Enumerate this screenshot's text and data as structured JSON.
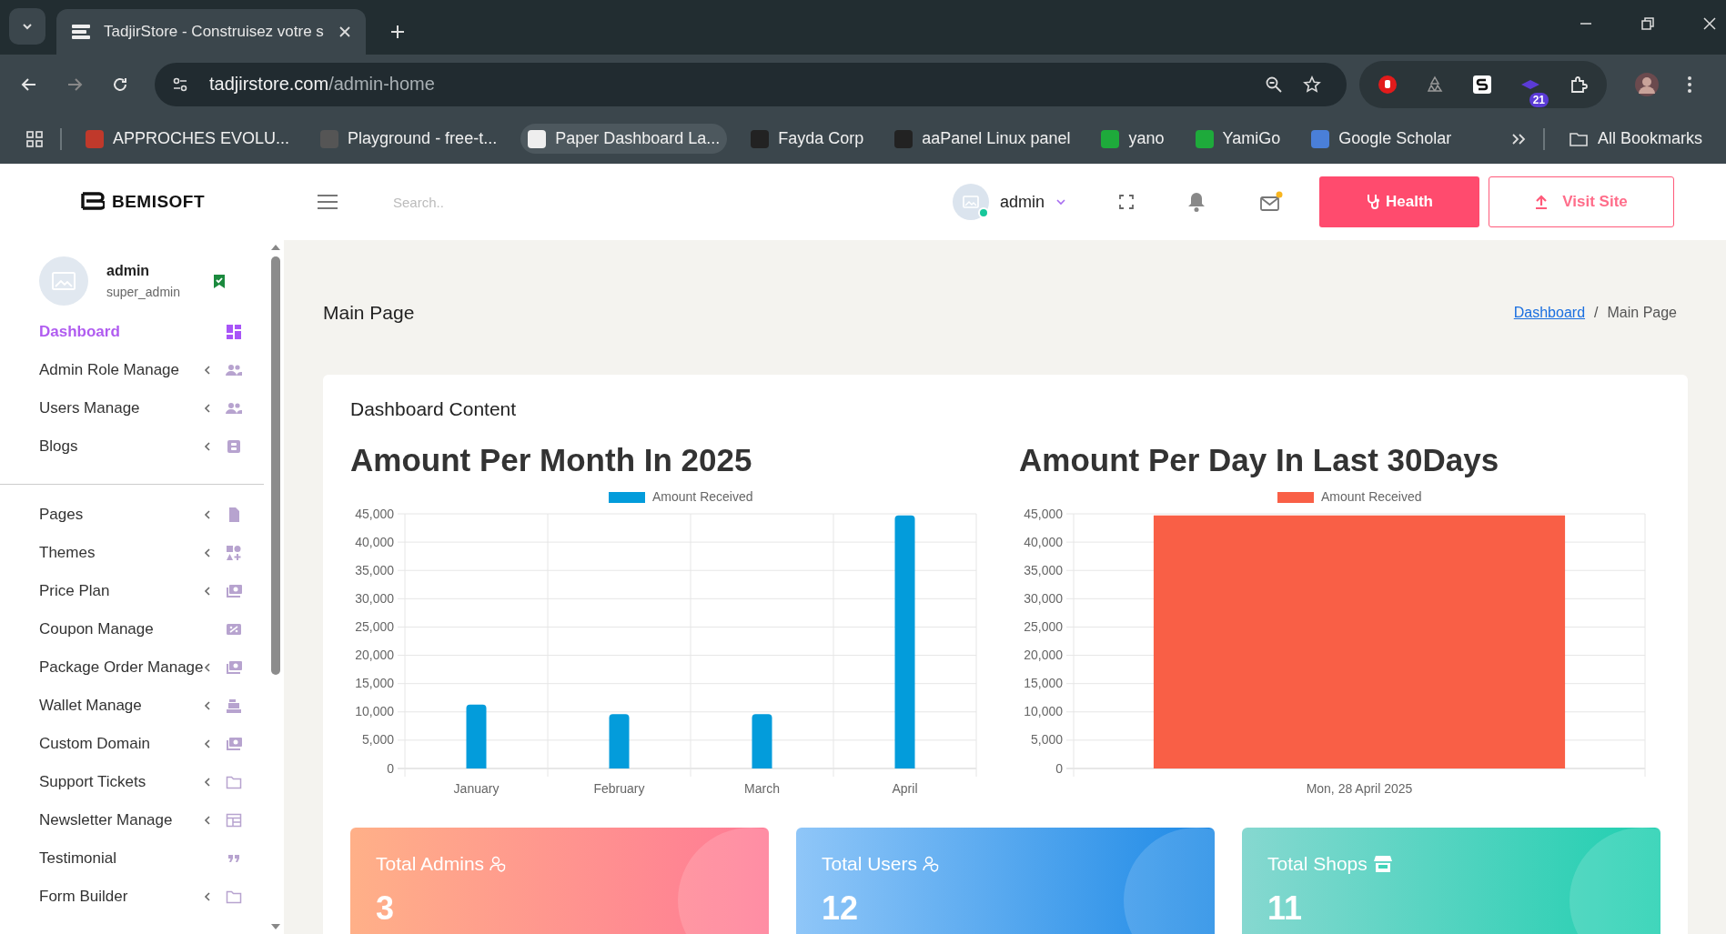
{
  "browser": {
    "tab_title": "TadjirStore - Construisez votre s",
    "url_host": "tadjirstore.com",
    "url_path": "/admin-home",
    "extension_badge": "21",
    "bookmarks": [
      {
        "label": "APPROCHES EVOLU...",
        "selected": false
      },
      {
        "label": "Playground - free-t...",
        "selected": false
      },
      {
        "label": "Paper Dashboard La...",
        "selected": true
      },
      {
        "label": "Fayda Corp",
        "selected": false
      },
      {
        "label": "aaPanel Linux panel",
        "selected": false
      },
      {
        "label": "yano",
        "selected": false
      },
      {
        "label": "YamiGo",
        "selected": false
      },
      {
        "label": "Google Scholar",
        "selected": false
      }
    ],
    "all_bookmarks": "All Bookmarks"
  },
  "header": {
    "logo": "BEMISOFT",
    "search_placeholder": "Search..",
    "user": "admin",
    "health_button": "Health",
    "visit_button": "Visit Site"
  },
  "sidebar": {
    "user_name": "admin",
    "user_role": "super_admin",
    "groups": [
      {
        "items": [
          {
            "label": "Dashboard",
            "selected": true,
            "has_submenu": false
          },
          {
            "label": "Admin Role Manage",
            "selected": false,
            "has_submenu": true
          },
          {
            "label": "Users Manage",
            "selected": false,
            "has_submenu": true
          },
          {
            "label": "Blogs",
            "selected": false,
            "has_submenu": true
          }
        ]
      },
      {
        "items": [
          {
            "label": "Pages",
            "selected": false,
            "has_submenu": true
          },
          {
            "label": "Themes",
            "selected": false,
            "has_submenu": true
          },
          {
            "label": "Price Plan",
            "selected": false,
            "has_submenu": true
          },
          {
            "label": "Coupon Manage",
            "selected": false,
            "has_submenu": false
          },
          {
            "label": "Package Order Manage",
            "selected": false,
            "has_submenu": true
          },
          {
            "label": "Wallet Manage",
            "selected": false,
            "has_submenu": true
          },
          {
            "label": "Custom Domain",
            "selected": false,
            "has_submenu": true
          },
          {
            "label": "Support Tickets",
            "selected": false,
            "has_submenu": true
          },
          {
            "label": "Newsletter Manage",
            "selected": false,
            "has_submenu": true
          },
          {
            "label": "Testimonial",
            "selected": false,
            "has_submenu": false
          },
          {
            "label": "Form Builder",
            "selected": false,
            "has_submenu": true
          }
        ]
      }
    ]
  },
  "main": {
    "title": "Main Page",
    "breadcrumb_separator": "/",
    "breadcrumb": [
      {
        "label": "Dashboard",
        "link": true
      },
      {
        "label": "Main Page",
        "link": false
      }
    ],
    "card_title": "Dashboard Content",
    "charts": [
      {
        "heading": "Amount Per Month In 2025",
        "chart_data": {
          "type": "bar",
          "categories": [
            "January",
            "February",
            "March",
            "April"
          ],
          "series": [
            {
              "name": "Amount Received",
              "color": "#039cdb",
              "values": [
                11300,
                9600,
                9600,
                44700
              ]
            }
          ],
          "grid": true,
          "ylim": [
            0,
            45000
          ],
          "yticks": [
            {
              "value": 0,
              "label": "0"
            },
            {
              "value": 5000,
              "label": "5,000"
            },
            {
              "value": 10000,
              "label": "10,000"
            },
            {
              "value": 15000,
              "label": "15,000"
            },
            {
              "value": 20000,
              "label": "20,000"
            },
            {
              "value": 25000,
              "label": "25,000"
            },
            {
              "value": 30000,
              "label": "30,000"
            },
            {
              "value": 35000,
              "label": "35,000"
            },
            {
              "value": 40000,
              "label": "40,000"
            },
            {
              "value": 45000,
              "label": "45,000"
            }
          ]
        }
      },
      {
        "heading": "Amount Per Day In Last 30Days",
        "chart_data": {
          "type": "bar",
          "categories": [
            "Mon, 28 April 2025"
          ],
          "series": [
            {
              "name": "Amount Received",
              "color": "#f95f46",
              "values": [
                44700
              ]
            }
          ],
          "grid": true,
          "ylim": [
            0,
            45000
          ],
          "yticks": [
            {
              "value": 0,
              "label": "0"
            },
            {
              "value": 5000,
              "label": "5,000"
            },
            {
              "value": 10000,
              "label": "10,000"
            },
            {
              "value": 15000,
              "label": "15,000"
            },
            {
              "value": 20000,
              "label": "20,000"
            },
            {
              "value": 25000,
              "label": "25,000"
            },
            {
              "value": 30000,
              "label": "30,000"
            },
            {
              "value": 35000,
              "label": "35,000"
            },
            {
              "value": 40000,
              "label": "40,000"
            },
            {
              "value": 45000,
              "label": "45,000"
            }
          ]
        }
      }
    ],
    "stats": [
      {
        "label": "Total Admins",
        "value": "3"
      },
      {
        "label": "Total Users",
        "value": "12"
      },
      {
        "label": "Total Shops",
        "value": "11"
      }
    ]
  }
}
